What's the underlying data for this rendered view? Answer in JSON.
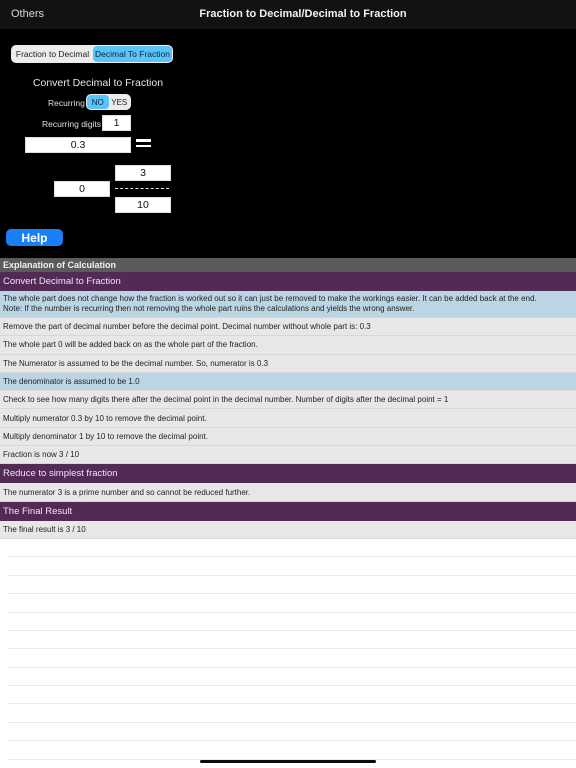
{
  "navbar": {
    "back_label": "Others",
    "title": "Fraction to Decimal/Decimal to Fraction"
  },
  "mode_segment": {
    "options": [
      "Fraction to Decimal",
      "Decimal To Fraction"
    ],
    "selected": "Decimal To Fraction"
  },
  "converter": {
    "heading": "Convert Decimal to Fraction",
    "recurring_label": "Recurring",
    "recurring_options": [
      "NO",
      "YES"
    ],
    "recurring_selected": "NO",
    "recurring_digits_label": "Recurring digits",
    "recurring_digits_value": "1",
    "decimal_value": "0.3",
    "equals_symbol": "=",
    "result_whole": "0",
    "result_numerator": "3",
    "result_denominator": "10",
    "help_label": "Help"
  },
  "explanation": {
    "title": "Explanation of Calculation",
    "rows": [
      {
        "type": "section",
        "text": "Convert Decimal to Fraction"
      },
      {
        "type": "highlight",
        "text": "The whole part does not change how the fraction is worked out so it can just be removed to make the workings easier. It can be added back at the end.",
        "text2": "Note: If the number is recurring then not removing the whole part ruins the calculations and yields the wrong answer."
      },
      {
        "type": "plain",
        "text": "Remove the part of decimal number before the decimal point.  Decimal number without whole part is: 0.3"
      },
      {
        "type": "plain",
        "text": "The whole part 0 will be added back on as the whole part of the fraction."
      },
      {
        "type": "plain",
        "text": "The Numerator is assumed to be the decimal number.  So, numerator is 0.3"
      },
      {
        "type": "highlight",
        "text": "The denominator is assumed to be 1.0"
      },
      {
        "type": "plain",
        "text": "Check to see how many digits there after the decimal point in the decimal number. Number of digits after the decimal point = 1"
      },
      {
        "type": "plain",
        "text": "Multiply numerator 0.3 by 10 to remove the decimal point."
      },
      {
        "type": "plain",
        "text": "Multiply denominator 1 by 10 to remove the decimal point."
      },
      {
        "type": "plain",
        "text": "Fraction is now 3 / 10"
      },
      {
        "type": "section",
        "text": "Reduce to simplest fraction"
      },
      {
        "type": "plain",
        "text": "The numerator 3 is a prime number and so cannot be reduced further."
      },
      {
        "type": "section",
        "text": "The Final Result"
      },
      {
        "type": "plain",
        "text": "The final result is 3 / 10"
      }
    ]
  }
}
